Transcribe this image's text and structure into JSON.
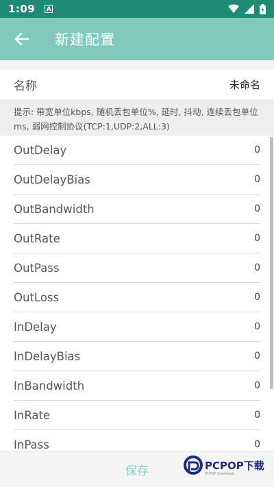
{
  "status_bar": {
    "time": "1:09",
    "notification_glyph": "A"
  },
  "header": {
    "title": "新建配置"
  },
  "name_field": {
    "label": "名称",
    "value": "未命名"
  },
  "hint": "提示: 带宽单位kbps, 随机丢包单位%, 延时, 抖动, 连续丢包单位ms, 弱网控制协议(TCP:1,UDP:2,ALL:3)",
  "params": [
    {
      "label": "OutDelay",
      "value": "0"
    },
    {
      "label": "OutDelayBias",
      "value": "0"
    },
    {
      "label": "OutBandwidth",
      "value": "0"
    },
    {
      "label": "OutRate",
      "value": "0"
    },
    {
      "label": "OutPass",
      "value": "0"
    },
    {
      "label": "OutLoss",
      "value": "0"
    },
    {
      "label": "InDelay",
      "value": "0"
    },
    {
      "label": "InDelayBias",
      "value": "0"
    },
    {
      "label": "InBandwidth",
      "value": "0"
    },
    {
      "label": "InRate",
      "value": "0"
    },
    {
      "label": "InPass",
      "value": "0"
    }
  ],
  "footer": {
    "save_label": "保存"
  },
  "watermark": {
    "brand": "PCPOP下载",
    "sub": "PCPOP Download"
  },
  "colors": {
    "status_bar": "#1f8a76",
    "app_bar": "#7fcabd",
    "accent_text": "#8ecfc3"
  }
}
